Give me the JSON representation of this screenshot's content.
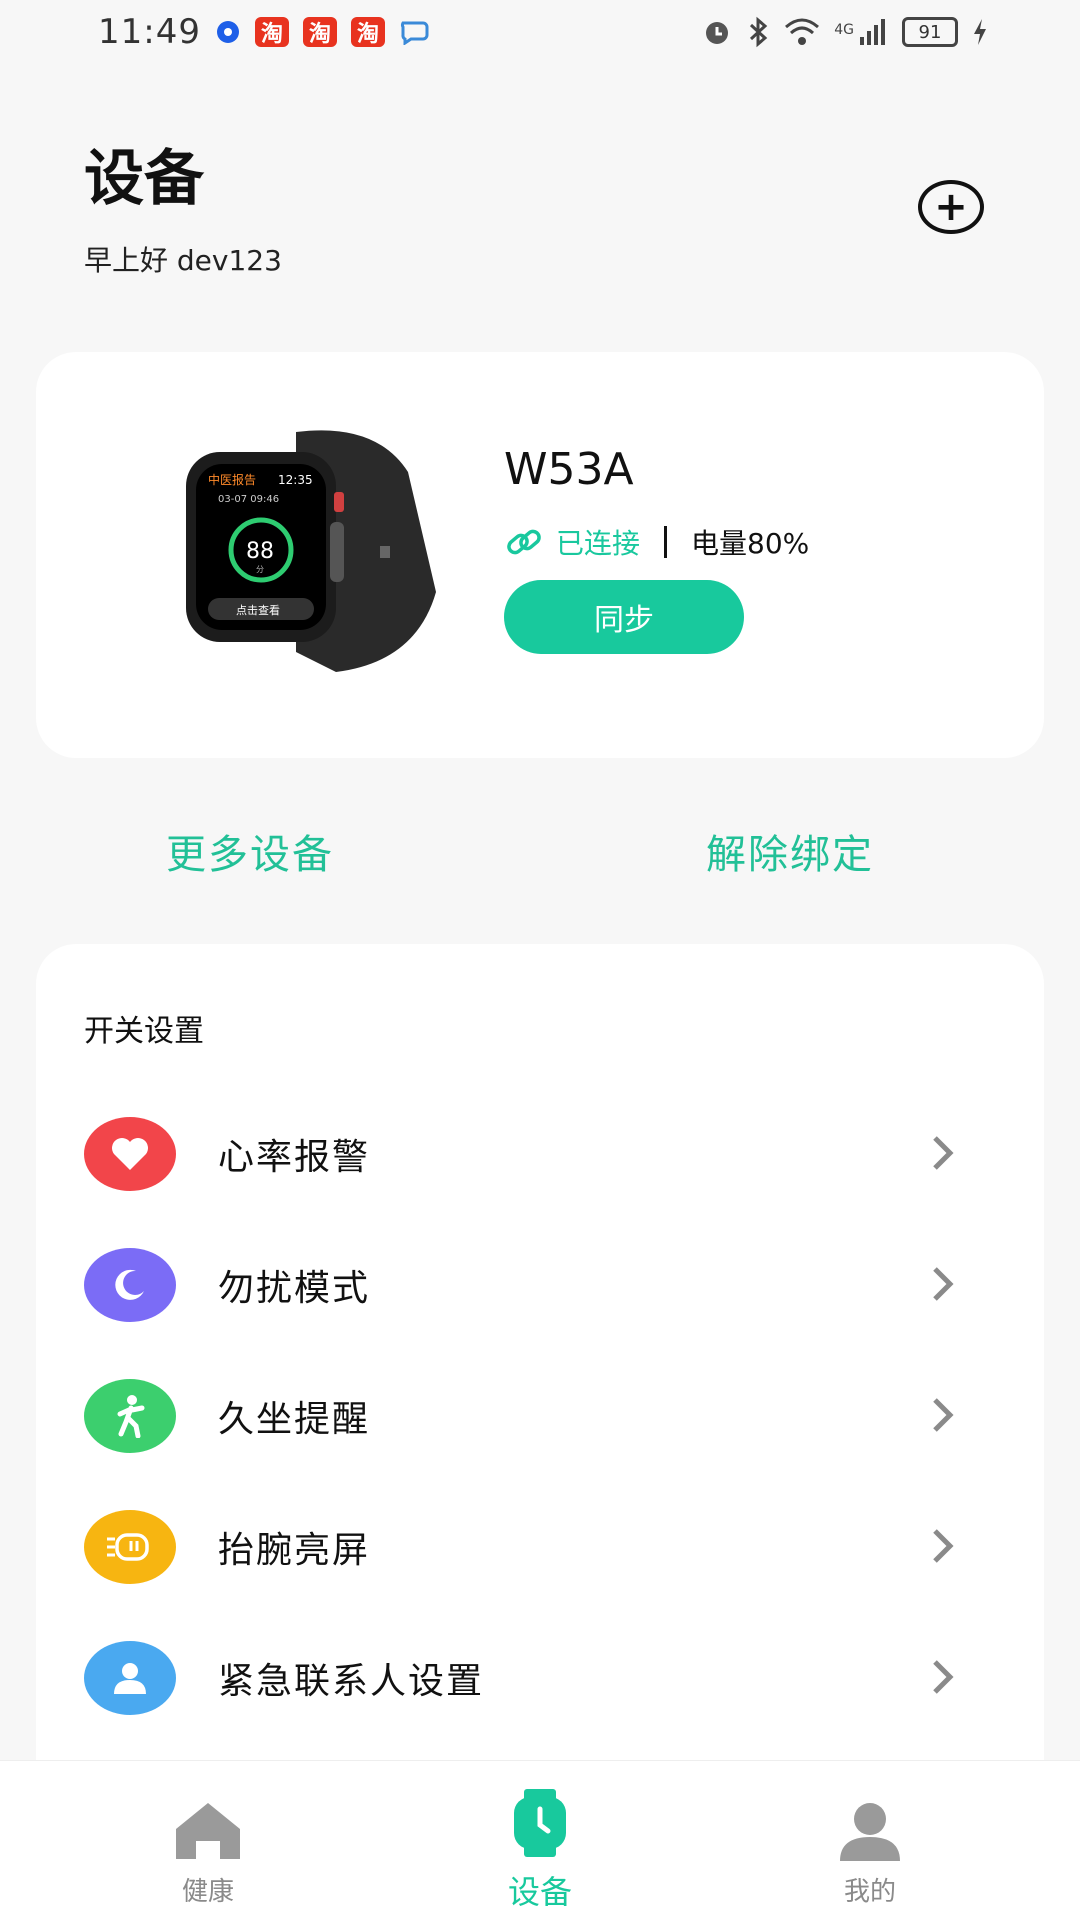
{
  "status_bar": {
    "time": "11:49",
    "app_badges": [
      "淘",
      "淘",
      "淘"
    ],
    "network": "4G",
    "battery": "91"
  },
  "header": {
    "title": "设备",
    "greeting": "早上好 dev123",
    "add_icon": "plus-circle-icon"
  },
  "device": {
    "name": "W53A",
    "status": "已连接",
    "battery_text": "电量80%",
    "sync_label": "同步",
    "watch_screen": {
      "title": "中医报告",
      "time": "12:35",
      "date": "03-07 09:46",
      "score": "88",
      "unit": "分",
      "button": "点击查看"
    }
  },
  "actions": {
    "more_devices": "更多设备",
    "unbind": "解除绑定"
  },
  "settings": {
    "title": "开关设置",
    "items": [
      {
        "label": "心率报警",
        "icon": "heart-icon",
        "color": "#f2454a"
      },
      {
        "label": "勿扰模式",
        "icon": "moon-icon",
        "color": "#7b6cf6"
      },
      {
        "label": "久坐提醒",
        "icon": "walking-person-icon",
        "color": "#3ccf6e"
      },
      {
        "label": "抬腕亮屏",
        "icon": "wrist-raise-icon",
        "color": "#f7b511"
      },
      {
        "label": "紧急联系人设置",
        "icon": "person-icon",
        "color": "#4aa9f0"
      }
    ]
  },
  "nav": {
    "items": [
      {
        "label": "健康",
        "icon": "home-icon"
      },
      {
        "label": "设备",
        "icon": "watch-icon",
        "active": true
      },
      {
        "label": "我的",
        "icon": "profile-icon"
      }
    ]
  },
  "colors": {
    "accent": "#18c99d",
    "background": "#f7f7f7"
  }
}
